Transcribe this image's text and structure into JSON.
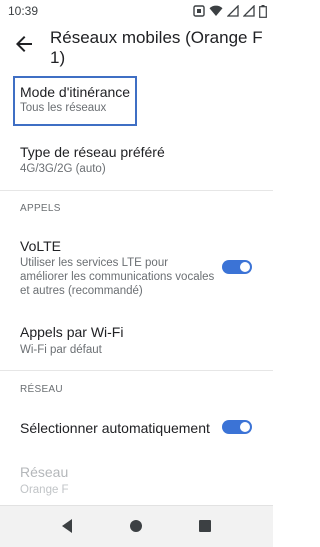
{
  "status_bar": {
    "time": "10:39",
    "icons": [
      "nfc-icon",
      "wifi-icon",
      "signal-icon",
      "signal-icon",
      "battery-icon"
    ]
  },
  "header": {
    "title": "Réseaux mobiles (Orange F 1)"
  },
  "items": {
    "roaming": {
      "title": "Mode d'itinérance",
      "subtitle": "Tous les réseaux"
    },
    "network_type": {
      "title": "Type de réseau préféré",
      "subtitle": "4G/3G/2G (auto)"
    },
    "volte": {
      "title": "VoLTE",
      "subtitle": "Utiliser les services LTE pour améliorer les communications vocales et autres (recommandé)",
      "enabled": true
    },
    "wifi_calls": {
      "title": "Appels par Wi-Fi",
      "subtitle": "Wi-Fi par défaut"
    },
    "auto_select": {
      "title": "Sélectionner automatiquement",
      "enabled": true
    },
    "network": {
      "title": "Réseau",
      "subtitle": "Orange F"
    }
  },
  "sections": {
    "calls": "APPELS",
    "network": "RÉSEAU"
  },
  "colors": {
    "accent": "#3b73d6",
    "focus": "#3f6fc4"
  }
}
